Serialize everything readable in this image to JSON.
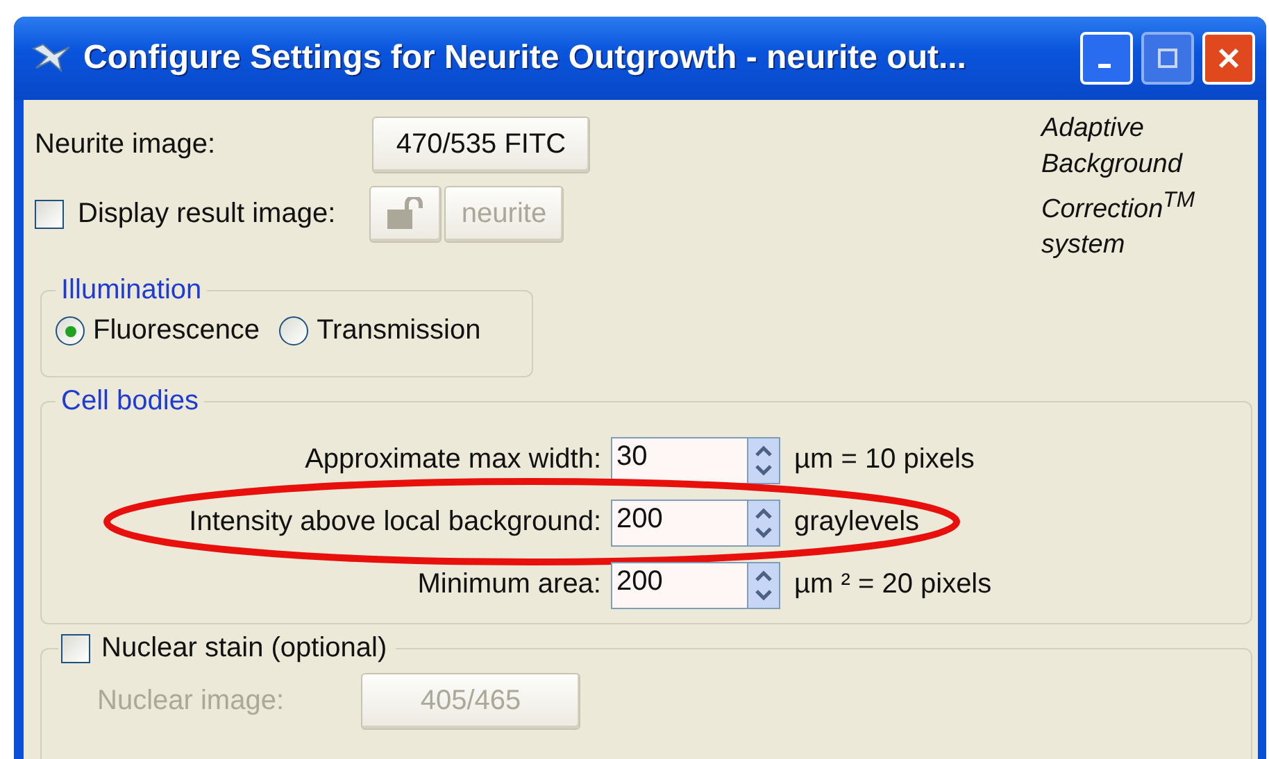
{
  "window": {
    "title": "Configure Settings for Neurite Outgrowth - neurite out..."
  },
  "neurite_image": {
    "label": "Neurite image:",
    "button": "470/535 FITC"
  },
  "display_result": {
    "label": "Display result image:",
    "checked": false,
    "button": "neurite",
    "disabled": true
  },
  "adaptive_note": [
    "Adaptive",
    "Background",
    "Correction$^{TM}$",
    "system"
  ],
  "illumination": {
    "title": "Illumination",
    "options": [
      {
        "label": "Fluorescence",
        "selected": true
      },
      {
        "label": "Transmission",
        "selected": false
      }
    ]
  },
  "cell_bodies": {
    "title": "Cell bodies",
    "fields": [
      {
        "label": "Approximate max width:",
        "value": "30",
        "unit": "µm = 10 pixels",
        "highlighted": false
      },
      {
        "label": "Intensity above local background:",
        "value": "200",
        "unit": "graylevels",
        "highlighted": true
      },
      {
        "label": "Minimum area:",
        "value": "200",
        "unit": "µm ² = 20 pixels",
        "highlighted": false
      }
    ]
  },
  "nuclear_stain": {
    "label": "Nuclear stain (optional)",
    "checked": false,
    "image_label": "Nuclear image:",
    "button": "405/465",
    "disabled": true
  }
}
